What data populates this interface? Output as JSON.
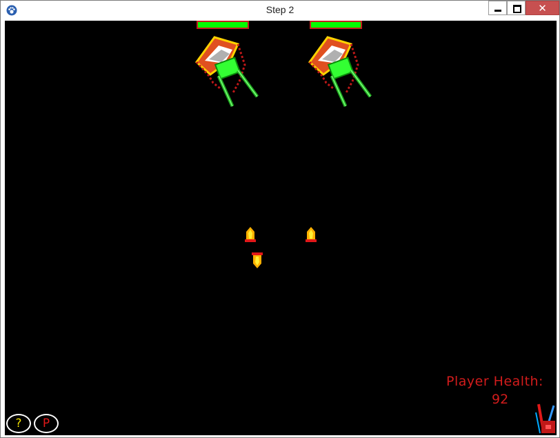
{
  "window": {
    "title": "Step 2",
    "app_icon": "paw-icon",
    "buttons": {
      "minimize": "minimize-icon",
      "maximize": "maximize-icon",
      "close_glyph": "✕"
    }
  },
  "game": {
    "background": "#000000",
    "enemies": [
      {
        "id": "enemy-1",
        "health_fraction": 1.0
      },
      {
        "id": "enemy-2",
        "health_fraction": 1.0
      }
    ],
    "bullets_count": 3,
    "player_health_label": "Player Health:",
    "player_health_value": "92",
    "help_button_label": "?",
    "pause_button_label": "P",
    "colors": {
      "health_bar": "#00ff00",
      "health_bar_border": "#c41e1e",
      "hud_text": "#d21c1c",
      "help_text": "#f0e000",
      "pause_text": "#e01818"
    }
  }
}
